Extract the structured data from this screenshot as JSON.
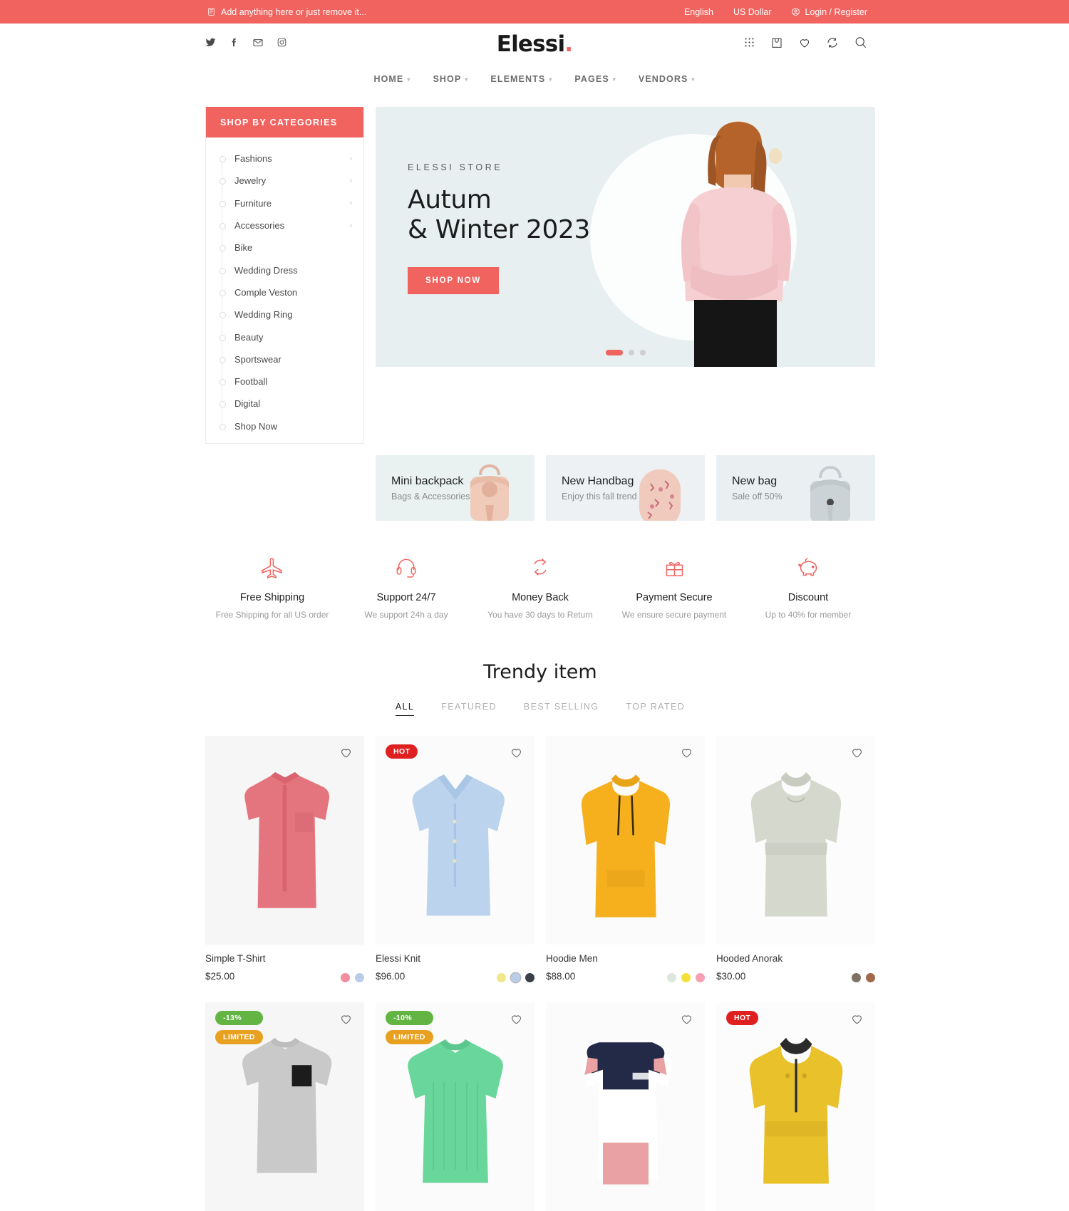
{
  "topbar": {
    "notice_icon": "megaphone-icon",
    "notice": "Add anything here or just remove it...",
    "language": "English",
    "currency": "US Dollar",
    "account_icon": "user-circle-icon",
    "account": "Login / Register"
  },
  "header": {
    "social": [
      {
        "name": "twitter-icon",
        "glyph": "𝕏"
      },
      {
        "name": "facebook-icon",
        "glyph": "f"
      },
      {
        "name": "email-icon",
        "glyph": "✉"
      },
      {
        "name": "instagram-icon",
        "glyph": "◻"
      }
    ],
    "logo": "Elessi",
    "logo_dot": ".",
    "icons": [
      "apps-grid-icon",
      "shopping-bag-icon",
      "wishlist-heart-icon",
      "compare-icon",
      "search-icon"
    ]
  },
  "nav": [
    {
      "label": "HOME",
      "has_caret": true
    },
    {
      "label": "SHOP",
      "has_caret": true
    },
    {
      "label": "ELEMENTS",
      "has_caret": true
    },
    {
      "label": "PAGES",
      "has_caret": true
    },
    {
      "label": "VENDORS",
      "has_caret": true
    }
  ],
  "sidebar": {
    "title": "SHOP BY CATEGORIES",
    "accent": "#f0635f",
    "items": [
      {
        "label": "Fashions",
        "arrow": true
      },
      {
        "label": "Jewelry",
        "arrow": true
      },
      {
        "label": "Furniture",
        "arrow": true
      },
      {
        "label": "Accessories",
        "arrow": true
      },
      {
        "label": "Bike",
        "arrow": false
      },
      {
        "label": "Wedding Dress",
        "arrow": false
      },
      {
        "label": "Comple Veston",
        "arrow": false
      },
      {
        "label": "Wedding Ring",
        "arrow": false
      },
      {
        "label": "Beauty",
        "arrow": false
      },
      {
        "label": "Sportswear",
        "arrow": false
      },
      {
        "label": "Football",
        "arrow": false
      },
      {
        "label": "Digital",
        "arrow": false
      },
      {
        "label": "Shop Now",
        "arrow": false
      }
    ]
  },
  "hero": {
    "kicker": "ELESSI STORE",
    "title_line1": "Autum",
    "title_line2": "& Winter 2023",
    "cta": "SHOP NOW",
    "bg": "#e7eff0",
    "slides": 3,
    "active_slide": 1
  },
  "promos": [
    {
      "title": "Mini backpack",
      "subtitle": "Bags & Accessories",
      "image": "pink-backpack-image"
    },
    {
      "title": "New Handbag",
      "subtitle": "Enjoy this fall trend",
      "image": "floral-handbag-image"
    },
    {
      "title": "New bag",
      "subtitle": "Sale off 50%",
      "image": "grey-bag-image"
    }
  ],
  "services": [
    {
      "icon": "airplane-icon",
      "title": "Free Shipping",
      "subtitle": "Free Shipping for all US order"
    },
    {
      "icon": "headset-icon",
      "title": "Support 24/7",
      "subtitle": "We support 24h a day"
    },
    {
      "icon": "refresh-arrows-icon",
      "title": "Money Back",
      "subtitle": "You have 30 days to Return"
    },
    {
      "icon": "gift-icon",
      "title": "Payment Secure",
      "subtitle": "We ensure secure payment"
    },
    {
      "icon": "piggy-bank-icon",
      "title": "Discount",
      "subtitle": "Up to 40% for member"
    }
  ],
  "trendy": {
    "heading": "Trendy item",
    "tabs": [
      {
        "label": "ALL",
        "active": true
      },
      {
        "label": "FEATURED",
        "active": false
      },
      {
        "label": "BEST SELLING",
        "active": false
      },
      {
        "label": "TOP RATED",
        "active": false
      }
    ]
  },
  "products_row1": [
    {
      "name": "Simple T-Shirt",
      "price": "$25.00",
      "badges": [],
      "image": "pink-dress-shirt-image",
      "img_bg": "#f6f6f6",
      "swatches": [
        {
          "color": "#ef8fa0"
        },
        {
          "color": "#b9cde8"
        }
      ]
    },
    {
      "name": "Elessi Knit",
      "price": "$96.00",
      "badges": [
        {
          "text": "HOT",
          "type": "hot"
        }
      ],
      "image": "blue-knit-cardigan-image",
      "img_bg": "#fbfbfb",
      "swatches": [
        {
          "color": "#f2e68a"
        },
        {
          "color": "#b9cde8",
          "selected": true
        },
        {
          "color": "#3a3f4a"
        }
      ]
    },
    {
      "name": "Hoodie Men",
      "price": "$88.00",
      "badges": [],
      "image": "yellow-hoodie-image",
      "img_bg": "#fbfbfb",
      "swatches": [
        {
          "color": "#dde7dd"
        },
        {
          "color": "#f5e03a"
        },
        {
          "color": "#f79fb2"
        }
      ]
    },
    {
      "name": "Hooded Anorak",
      "price": "$30.00",
      "badges": [],
      "image": "grey-hooded-anorak-image",
      "img_bg": "#fcfcfc",
      "swatches": [
        {
          "color": "#7d7265"
        },
        {
          "color": "#a06a4a"
        }
      ]
    }
  ],
  "products_row2": [
    {
      "name": "",
      "price": "",
      "badges": [
        {
          "text": "-13%",
          "type": "discount"
        },
        {
          "text": "LIMITED",
          "type": "limited"
        }
      ],
      "image": "grey-pocket-tshirt-image",
      "img_bg": "#f6f6f6",
      "swatches": []
    },
    {
      "name": "",
      "price": "",
      "badges": [
        {
          "text": "-10%",
          "type": "discount"
        },
        {
          "text": "LIMITED",
          "type": "limited"
        }
      ],
      "image": "green-knit-sweater-image",
      "img_bg": "#fbfbfb",
      "swatches": []
    },
    {
      "name": "",
      "price": "",
      "badges": [],
      "image": "colorblock-tshirt-image",
      "img_bg": "#fbfbfb",
      "swatches": []
    },
    {
      "name": "",
      "price": "",
      "badges": [
        {
          "text": "HOT",
          "type": "hot"
        }
      ],
      "image": "yellow-anorak-jacket-image",
      "img_bg": "#fcfcfc",
      "swatches": []
    }
  ],
  "colors": {
    "accent": "#f0635f",
    "hot": "#e02020",
    "discount": "#62b543",
    "limited": "#e8a020",
    "hero_bg": "#e7eff0"
  }
}
